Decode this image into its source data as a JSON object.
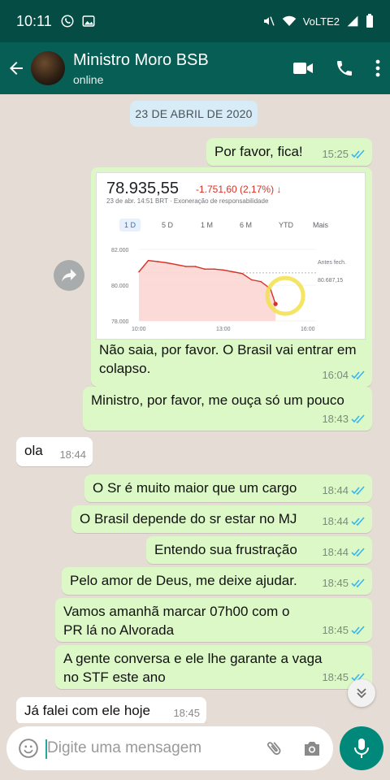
{
  "status_bar": {
    "time": "10:11",
    "network": "VoLTE2"
  },
  "header": {
    "contact_name": "Ministro Moro BSB",
    "contact_status": "online"
  },
  "date_chip": "23 DE ABRIL DE 2020",
  "messages": [
    {
      "text": "Por favor, fica!",
      "time": "15:25"
    },
    {
      "text": "Não saia, por favor.  O Brasil vai entrar em colapso.",
      "time": "16:04"
    },
    {
      "text": "Ministro, por favor, me ouça só um pouco",
      "time": "18:43"
    },
    {
      "text": "ola",
      "time": "18:44"
    },
    {
      "text": "O Sr é muito maior que um cargo",
      "time": "18:44"
    },
    {
      "text": "O Brasil depende do sr estar no MJ",
      "time": "18:44"
    },
    {
      "text": "Entendo sua frustração",
      "time": "18:44"
    },
    {
      "text": "Pelo amor de Deus, me deixe ajudar.",
      "time": "18:45"
    },
    {
      "text": "Vamos amanhã marcar 07h00 com o PR lá no Alvorada",
      "time": "18:45"
    },
    {
      "text": "A gente conversa e ele lhe garante a vaga no STF este ano",
      "time": "18:45"
    },
    {
      "text": "Já falei com ele hoje",
      "time": "18:45"
    }
  ],
  "stock_card": {
    "price": "78.935,55",
    "change": "-1.751,60 (2,17%) ↓",
    "subtitle": "23 de abr. 14:51 BRT · Exoneração de responsabilidade",
    "tabs": [
      "1 D",
      "5 D",
      "1 M",
      "6 M",
      "YTD",
      "Mais"
    ],
    "prev_close_label": "Antes fech.",
    "prev_close_value": "80.687,15"
  },
  "chart_data": {
    "type": "line",
    "x_ticks": [
      "10:00",
      "13:00",
      "16:00"
    ],
    "y_ticks": [
      "82.000",
      "80.000",
      "78.000"
    ],
    "ylim": [
      78000,
      82000
    ],
    "reference_line": 80687.15,
    "x": [
      "10:00",
      "10:20",
      "10:40",
      "11:00",
      "11:20",
      "11:40",
      "12:00",
      "12:20",
      "12:40",
      "13:00",
      "13:20",
      "13:40",
      "14:00",
      "14:20",
      "14:40",
      "14:51"
    ],
    "values": [
      80750,
      81380,
      81320,
      81250,
      81150,
      81050,
      81050,
      80900,
      80900,
      80850,
      80750,
      80650,
      80300,
      80200,
      79800,
      78950
    ]
  },
  "composer": {
    "placeholder": "Digite uma mensagem"
  },
  "colors": {
    "header": "#075e54",
    "statusbar": "#054d44",
    "outgoing": "#dcf8c6",
    "incoming": "#ffffff",
    "ticks": "#34b7f1",
    "accent": "#00897b"
  }
}
